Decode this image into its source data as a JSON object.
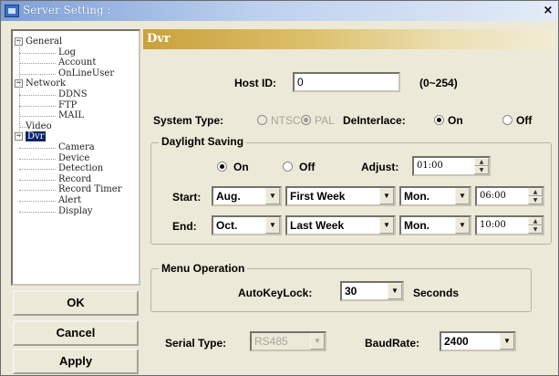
{
  "window": {
    "title": "Server Setting :",
    "close_glyph": "×"
  },
  "tree": {
    "items": [
      {
        "label": "General",
        "level": 0,
        "expander": "−"
      },
      {
        "label": "Log",
        "level": 1
      },
      {
        "label": "Account",
        "level": 1
      },
      {
        "label": "OnLineUser",
        "level": 1
      },
      {
        "label": "Network",
        "level": 0,
        "expander": "−"
      },
      {
        "label": "DDNS",
        "level": 1
      },
      {
        "label": "FTP",
        "level": 1
      },
      {
        "label": "MAIL",
        "level": 1
      },
      {
        "label": "Video",
        "level": 0
      },
      {
        "label": "Dvr",
        "level": 0,
        "expander": "−",
        "selected": true
      },
      {
        "label": "Camera",
        "level": 1
      },
      {
        "label": "Device",
        "level": 1
      },
      {
        "label": "Detection",
        "level": 1
      },
      {
        "label": "Record",
        "level": 1
      },
      {
        "label": "Record Timer",
        "level": 1
      },
      {
        "label": "Alert",
        "level": 1
      },
      {
        "label": "Display",
        "level": 1
      }
    ]
  },
  "buttons": {
    "ok": "OK",
    "cancel": "Cancel",
    "apply": "Apply"
  },
  "panel": {
    "title": "Dvr",
    "host_id": {
      "label": "Host ID:",
      "value": "0",
      "range": "(0~254)"
    },
    "system_type": {
      "label": "System Type:",
      "ntsc": "NTSC",
      "pal": "PAL",
      "selected": "PAL"
    },
    "deinterlace": {
      "label": "DeInterlace:",
      "on": "On",
      "off": "Off",
      "selected": "On"
    },
    "daylight": {
      "title": "Daylight Saving",
      "on": "On",
      "off": "Off",
      "selected": "On",
      "adjust_label": "Adjust:",
      "adjust_value": "01:00",
      "start": {
        "label": "Start:",
        "month": "Aug.",
        "week": "First Week",
        "day": "Mon.",
        "time": "06:00"
      },
      "end": {
        "label": "End:",
        "month": "Oct.",
        "week": "Last Week",
        "day": "Mon.",
        "time": "10:00"
      }
    },
    "menu_operation": {
      "title": "Menu Operation",
      "autokeylock_label": "AutoKeyLock:",
      "autokeylock_value": "30",
      "unit": "Seconds"
    },
    "serial": {
      "type_label": "Serial Type:",
      "type_value": "RS485",
      "baud_label": "BaudRate:",
      "baud_value": "2400"
    }
  },
  "colors": {
    "selection": "#0a246a",
    "panel_header": "#c9a13a",
    "window_face": "#ece9d8"
  }
}
